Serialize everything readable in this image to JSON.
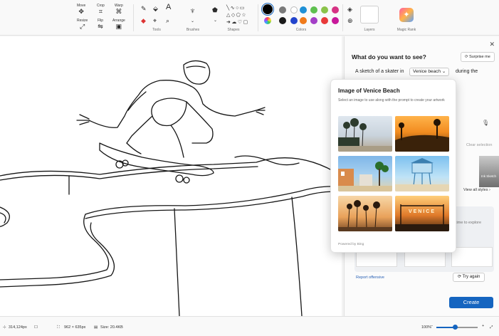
{
  "ribbon": {
    "tools": [
      {
        "id": "move",
        "label": "Move",
        "icon": "move-icon",
        "glyph": "✥"
      },
      {
        "id": "resize",
        "label": "Resize",
        "icon": "resize-icon",
        "glyph": "⤢"
      },
      {
        "id": "crop",
        "label": "Crop",
        "icon": "crop-icon",
        "glyph": "⌗"
      },
      {
        "id": "flip",
        "label": "Flip",
        "icon": "flip-icon",
        "glyph": "⇋"
      },
      {
        "id": "warp",
        "label": "Warp",
        "icon": "warp-icon",
        "glyph": "⌘"
      },
      {
        "id": "arrange",
        "label": "Arrange",
        "icon": "arrange-icon",
        "glyph": "▣"
      }
    ],
    "groups": {
      "tools": "Tools",
      "brushes": "Brushes",
      "shapes": "Shapes",
      "colors": "Colors",
      "layers": "Layers",
      "magic": "Magic Rank"
    },
    "colors": {
      "primary": "#000000",
      "swatches_top": [
        "#7a7a7a",
        "#1e90d6",
        "#5ec04f",
        "#8bc34a",
        "#d63384"
      ],
      "swatches_bottom": [
        "#1a1a1a",
        "#2244cc",
        "#ef7a1a",
        "#a33fc7",
        "#c8189a"
      ]
    }
  },
  "panel": {
    "title": "What do you want to see?",
    "surprise_label": "Surprise me",
    "prompt_prefix": "A sketch of a skater in",
    "prompt_chip": "Venice beach",
    "prompt_suffix": "during the",
    "clear_selection": "Clear selection",
    "view_all_styles": "View all styles",
    "thumb_caption": "Ink Sketch",
    "explore_text": "time to explore",
    "report_label": "Report offensive",
    "try_again_label": "Try again",
    "create_label": "Create"
  },
  "popup": {
    "title": "Image of Venice Beach",
    "subtitle": "Select an image to use along with the prompt to create your artwork",
    "powered_by": "Powered by Bing",
    "images": [
      {
        "name": "venice-boardwalk-palms",
        "theme": "boardwalk"
      },
      {
        "name": "venice-skatepark-sunset",
        "theme": "skatepark"
      },
      {
        "name": "venice-beach-storefronts",
        "theme": "storefront"
      },
      {
        "name": "venice-lifeguard-tower",
        "theme": "lifeguard"
      },
      {
        "name": "venice-palm-silhouettes",
        "theme": "palms"
      },
      {
        "name": "venice-sign-sunset",
        "theme": "sign",
        "sign_text": "VENICE"
      }
    ]
  },
  "status": {
    "cursor_pos": "314,124px",
    "selection_size": "962 × 635px",
    "file_size": "Size: 20.4KB",
    "zoom_level": "100%",
    "zoom_fraction": 0.45
  }
}
